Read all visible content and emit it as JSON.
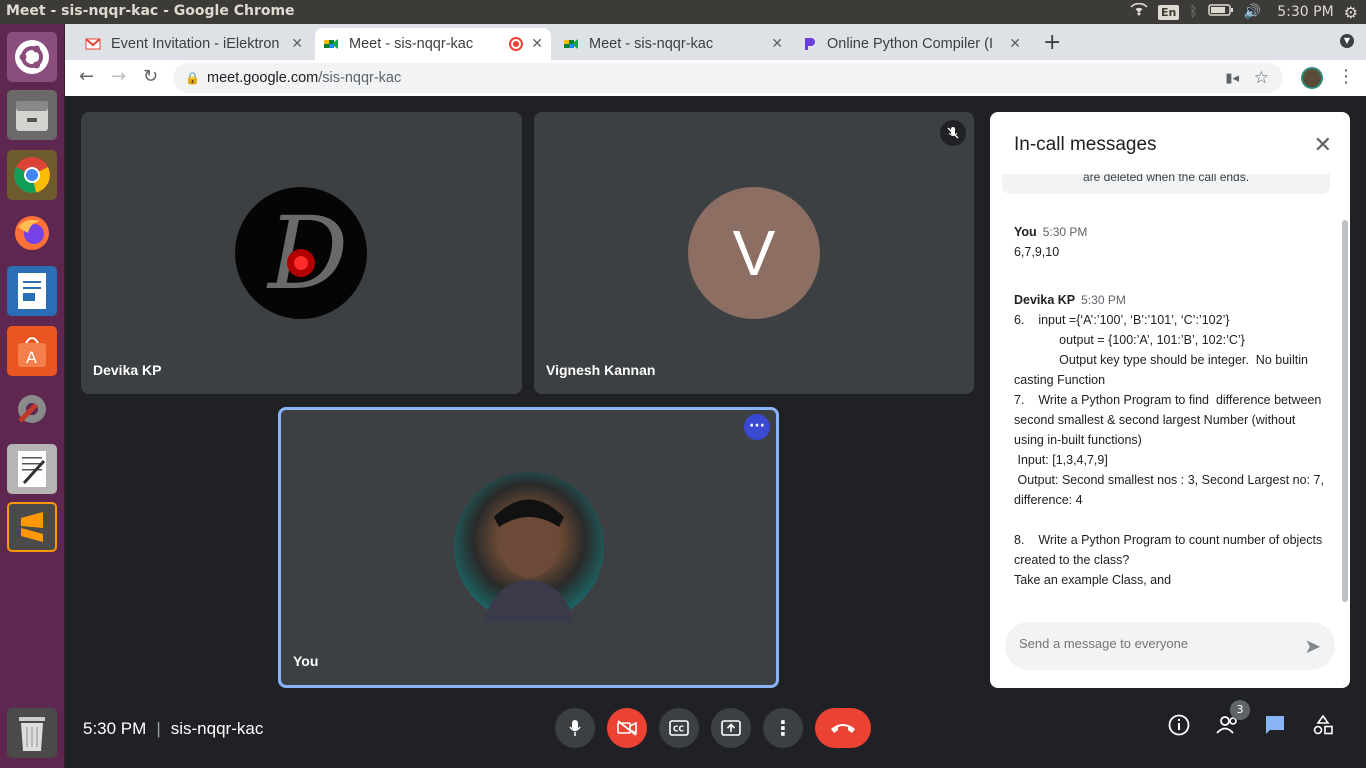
{
  "window": {
    "title": "Meet - sis-nqqr-kac - Google Chrome"
  },
  "system_tray": {
    "lang": "En",
    "clock": "5:30 PM"
  },
  "launcher": {
    "items": [
      "ubuntu-icon",
      "files-icon",
      "chrome-icon",
      "firefox-icon",
      "writer-icon",
      "software-center-icon",
      "settings-icon",
      "text-editor-icon",
      "sublime-icon",
      "trash-icon"
    ]
  },
  "browser": {
    "tabs": [
      {
        "label": "Event Invitation - iElektron"
      },
      {
        "label": "Meet - sis-nqqr-kac"
      },
      {
        "label": "Meet - sis-nqqr-kac"
      },
      {
        "label": "Online Python Compiler (I"
      }
    ],
    "url_domain": "meet.google.com",
    "url_path": "/sis-nqqr-kac"
  },
  "meet": {
    "participants": [
      {
        "name": "Devika KP"
      },
      {
        "name": "Vignesh Kannan",
        "initial": "V"
      },
      {
        "name": "You"
      }
    ],
    "time": "5:30 PM",
    "code": "sis-nqqr-kac",
    "people_count": "3"
  },
  "chat": {
    "title": "In-call messages",
    "notice": "are deleted when the call ends.",
    "messages": [
      {
        "sender": "You",
        "time": "5:30 PM",
        "lines": [
          "6,7,9,10"
        ]
      },
      {
        "sender": "Devika KP",
        "time": "5:30 PM",
        "lines": [
          "6.    input ={‘A’:’100’, ‘B’:’101’, ‘C’:’102’}",
          "             output = {100:’A’, 101:’B’, 102:’C’}",
          "             Output key type should be integer.  No builtin casting Function",
          "7.    Write a Python Program to find  difference between second smallest & second largest Number (without using in-built functions)",
          " Input: [1,3,4,7,9]",
          " Output: Second smallest nos : 3, Second Largest no: 7, difference: 4",
          "",
          "8.    Write a Python Program to count number of objects created to the class?",
          "Take an example Class, and"
        ]
      }
    ],
    "input_placeholder": "Send a message to everyone"
  }
}
